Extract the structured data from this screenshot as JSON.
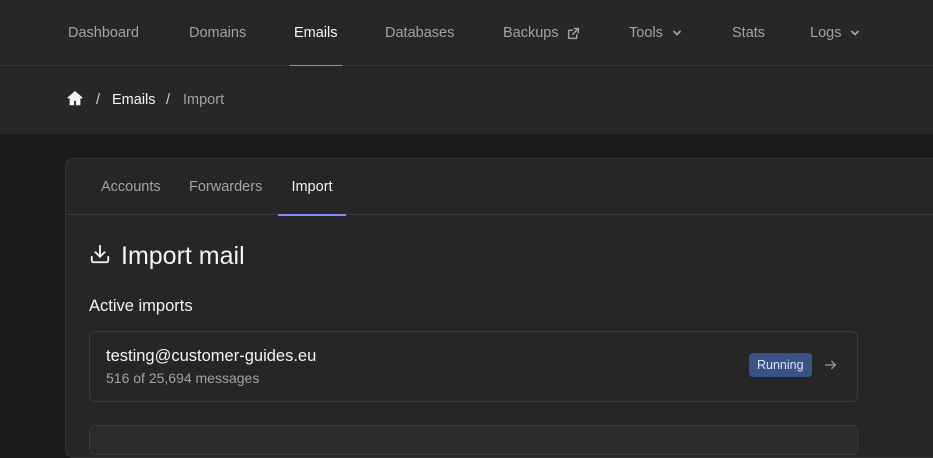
{
  "topnav": {
    "items": [
      {
        "label": "Dashboard"
      },
      {
        "label": "Domains"
      },
      {
        "label": "Emails"
      },
      {
        "label": "Databases"
      },
      {
        "label": "Backups"
      },
      {
        "label": "Tools"
      },
      {
        "label": "Stats"
      },
      {
        "label": "Logs"
      }
    ],
    "active": "Emails"
  },
  "breadcrumb": {
    "sep": "/",
    "items": [
      {
        "label": "Emails"
      },
      {
        "label": "Import"
      }
    ]
  },
  "tabs": [
    {
      "label": "Accounts"
    },
    {
      "label": "Forwarders"
    },
    {
      "label": "Import"
    }
  ],
  "active_tab": "Import",
  "page": {
    "title": "Import mail",
    "section_title": "Active imports"
  },
  "imports": [
    {
      "email": "testing@customer-guides.eu",
      "progress": "516 of 25,694 messages",
      "status": "Running"
    }
  ],
  "colors": {
    "accent": "#818cf8",
    "badge_bg": "#3b5287"
  },
  "icons": [
    "external-link-icon",
    "chevron-down-icon",
    "home-icon",
    "download-icon",
    "arrow-right-icon"
  ]
}
